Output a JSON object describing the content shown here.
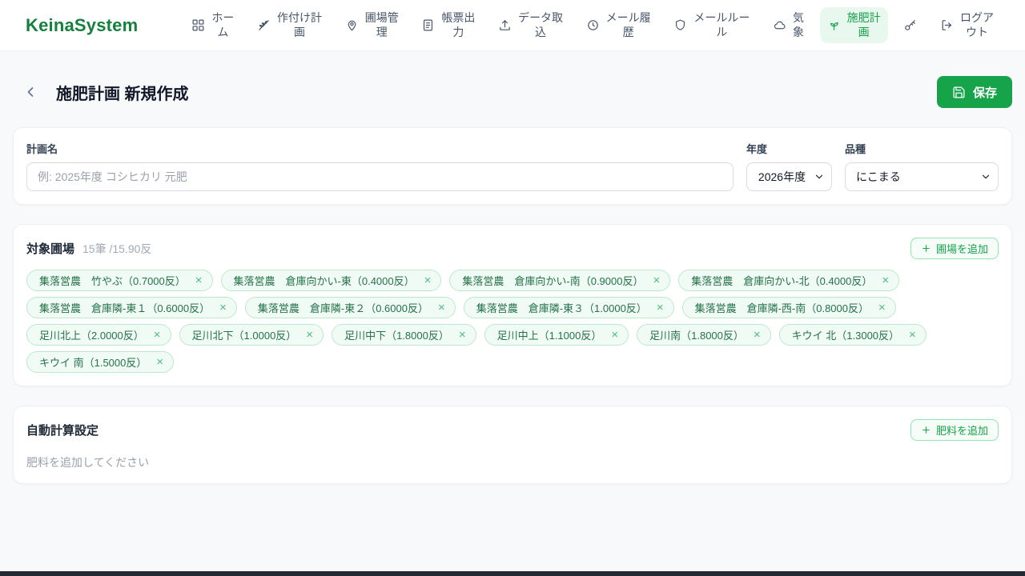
{
  "nav": {
    "logo": "KeinaSystem",
    "items": [
      {
        "label": "ホー\nム",
        "icon": "grid"
      },
      {
        "label": "作付け計\n画",
        "icon": "wheat"
      },
      {
        "label": "圃場管\n理",
        "icon": "map-pin"
      },
      {
        "label": "帳票出\n力",
        "icon": "document"
      },
      {
        "label": "データ取\n込",
        "icon": "upload"
      },
      {
        "label": "メール履\n歴",
        "icon": "history-clock"
      },
      {
        "label": "メールルー\nル",
        "icon": "shield"
      },
      {
        "label": "気\n象",
        "icon": "cloud"
      },
      {
        "label": "施肥計\n画",
        "icon": "sprout",
        "active": true
      },
      {
        "label": "",
        "icon": "key"
      },
      {
        "label": "ログア\nウト",
        "icon": "logout"
      }
    ]
  },
  "header": {
    "title": "施肥計画 新規作成",
    "save_label": "保存"
  },
  "form": {
    "plan_name_label": "計画名",
    "plan_name_placeholder": "例: 2025年度 コシヒカリ 元肥",
    "plan_name_value": "",
    "year_label": "年度",
    "year_value": "2026年度",
    "variety_label": "品種",
    "variety_value": "にこまる"
  },
  "fields": {
    "title": "対象圃場",
    "count_text": "15筆 /15.90反",
    "add_label": "圃場を追加",
    "chips": [
      {
        "label": "集落営農　竹やぶ（0.7000反）"
      },
      {
        "label": "集落営農　倉庫向かい-東（0.4000反）"
      },
      {
        "label": "集落営農　倉庫向かい-南（0.9000反）"
      },
      {
        "label": "集落営農　倉庫向かい-北（0.4000反）"
      },
      {
        "label": "集落営農　倉庫隣-東１（0.6000反）"
      },
      {
        "label": "集落営農　倉庫隣-東２（0.6000反）"
      },
      {
        "label": "集落営農　倉庫隣-東３（1.0000反）"
      },
      {
        "label": "集落営農　倉庫隣-西-南（0.8000反）"
      },
      {
        "label": "足川北上（2.0000反）"
      },
      {
        "label": "足川北下（1.0000反）"
      },
      {
        "label": "足川中下（1.8000反）"
      },
      {
        "label": "足川中上（1.1000反）"
      },
      {
        "label": "足川南（1.8000反）"
      },
      {
        "label": "キウイ 北（1.3000反）"
      },
      {
        "label": "キウイ 南（1.5000反）"
      }
    ]
  },
  "auto_calc": {
    "title": "自動計算設定",
    "add_label": "肥料を追加",
    "empty_text": "肥料を追加してください"
  },
  "colors": {
    "primary": "#16a34a",
    "logo_green": "#15803d",
    "active_nav_bg": "#e9f8ef",
    "chip_bg": "#f1fbf5",
    "chip_border": "#bce9cc",
    "chip_text": "#25714a",
    "page_bg": "#f8f9fb"
  }
}
